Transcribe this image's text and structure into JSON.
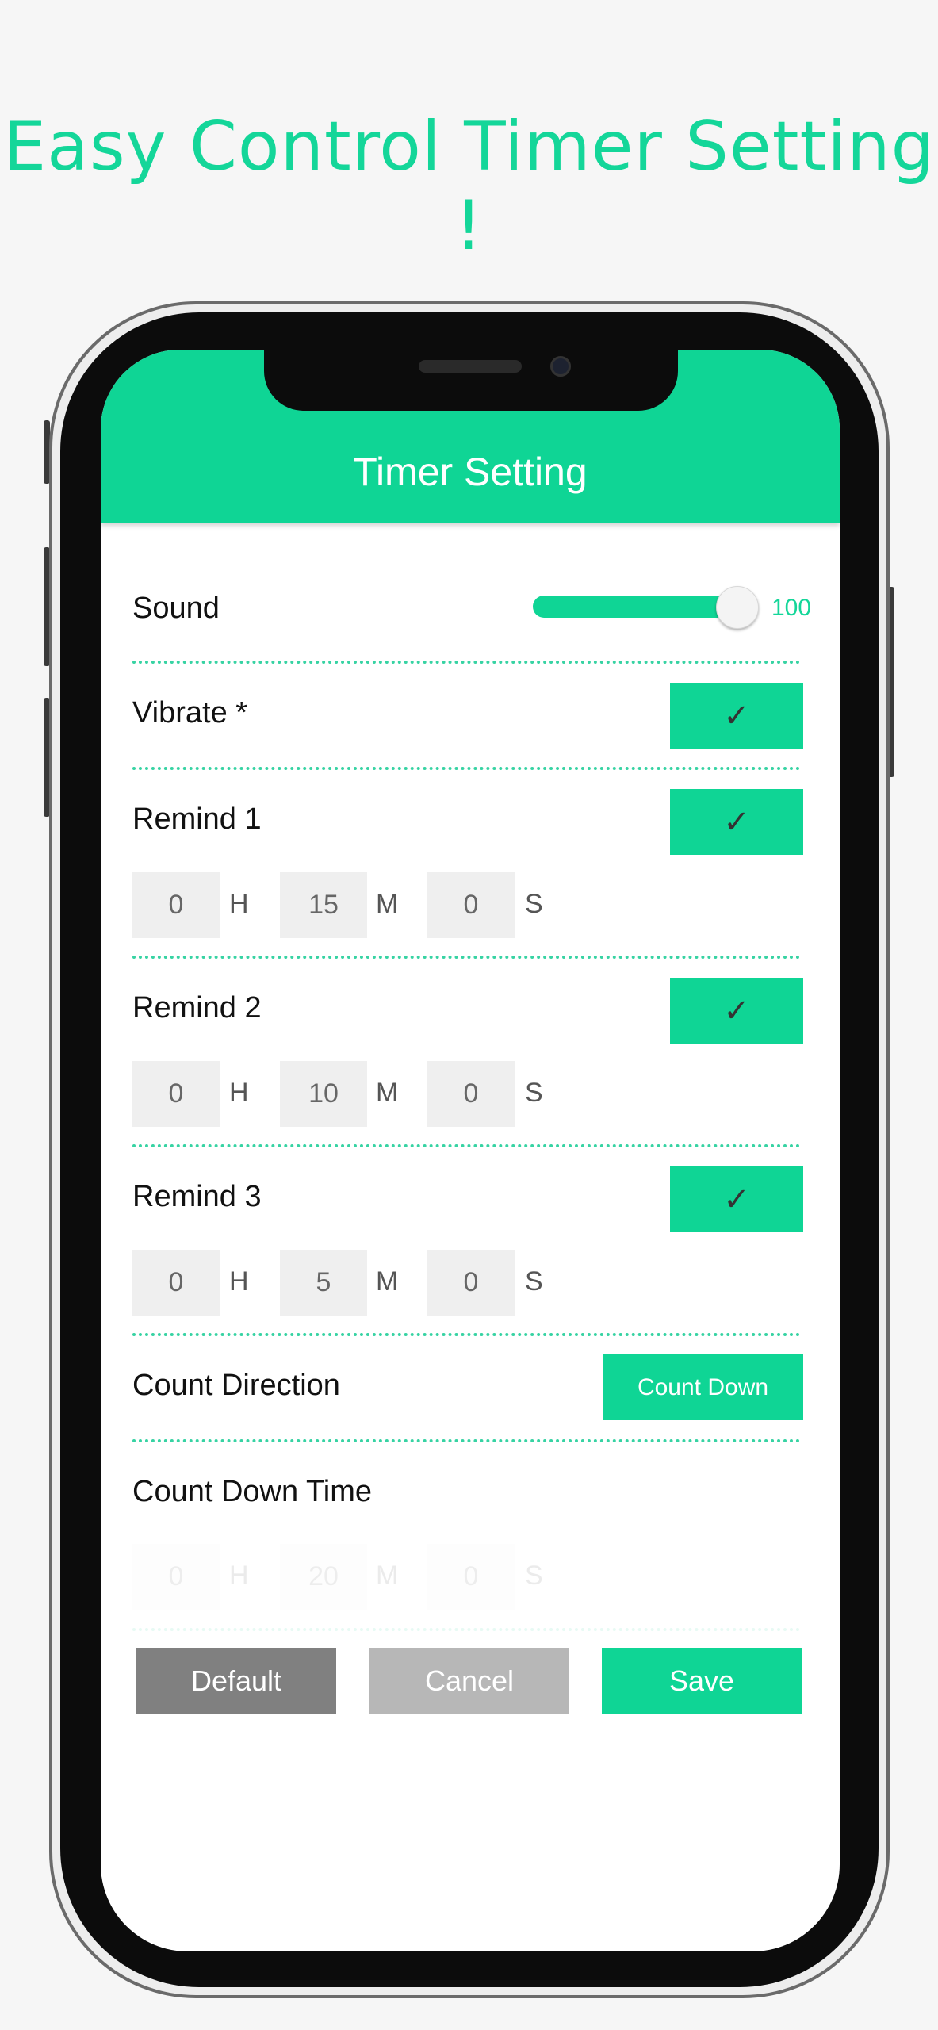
{
  "headline": "Easy Control Timer Setting !",
  "appbar": {
    "title": "Timer Setting"
  },
  "sound": {
    "label": "Sound",
    "value": "100",
    "level": 1.0
  },
  "vibrate": {
    "label": "Vibrate *",
    "check": "✓"
  },
  "remind1": {
    "label": "Remind 1",
    "check": "✓",
    "h": "0",
    "m": "15",
    "s": "0"
  },
  "remind2": {
    "label": "Remind 2",
    "check": "✓",
    "h": "0",
    "m": "10",
    "s": "0"
  },
  "remind3": {
    "label": "Remind 3",
    "check": "✓",
    "h": "0",
    "m": "5",
    "s": "0"
  },
  "units": {
    "h": "H",
    "m": "M",
    "s": "S"
  },
  "count_direction": {
    "label": "Count Direction",
    "value": "Count Down"
  },
  "countdown_time": {
    "label": "Count Down Time",
    "h": "0",
    "m": "20",
    "s": "0"
  },
  "buttons": {
    "default": "Default",
    "cancel": "Cancel",
    "save": "Save"
  },
  "colors": {
    "accent": "#0fd595",
    "default_btn": "#808080",
    "cancel_btn": "#b7b7b7"
  }
}
